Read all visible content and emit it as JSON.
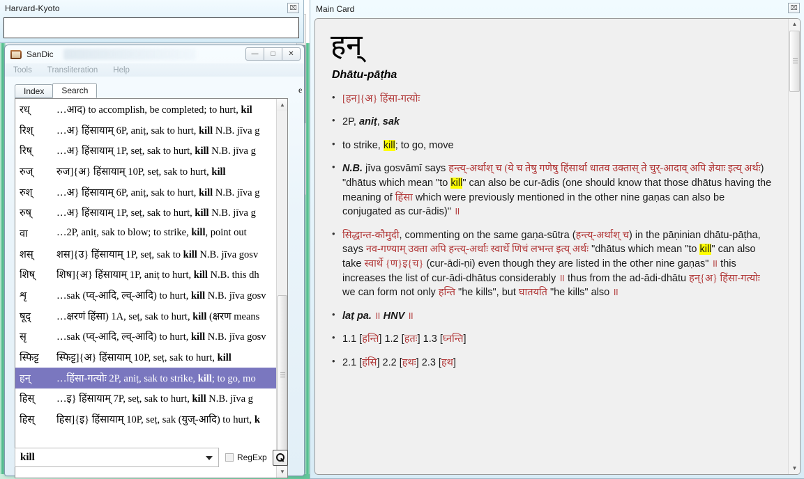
{
  "harvard_kyoto": {
    "title": "Harvard-Kyoto",
    "close_label": "⌧",
    "input_value": "",
    "input_placeholder": ""
  },
  "sandic": {
    "title": "SanDic",
    "window_buttons": {
      "minimize": "—",
      "maximize": "□",
      "close": "✕"
    },
    "menu": [
      "Tools",
      "Transliteration",
      "Help"
    ],
    "tabs": [
      {
        "label": "Index",
        "active": false
      },
      {
        "label": "Search",
        "active": true
      }
    ],
    "list_rows": [
      {
        "headword": "रध्",
        "gloss_pre": "…आद) to accomplish, be completed; to hurt, ",
        "gloss_bold": "kil",
        "gloss_post": "",
        "selected": false
      },
      {
        "headword": "रिश्",
        "gloss_pre": "…अ} हिंसायाम् 6P, aniṭ, sak to hurt, ",
        "gloss_bold": "kill",
        "gloss_post": " N.B. jīva g",
        "selected": false
      },
      {
        "headword": "रिष्",
        "gloss_pre": "…अ} हिंसायाम् 1P, seṭ, sak to hurt, ",
        "gloss_bold": "kill",
        "gloss_post": " N.B. jīva g",
        "selected": false
      },
      {
        "headword": "रुज्",
        "gloss_pre": "रुज]{अ} हिंसायाम् 10P, seṭ, sak to hurt, ",
        "gloss_bold": "kill",
        "gloss_post": "",
        "selected": false
      },
      {
        "headword": "रुश्",
        "gloss_pre": "…अ} हिंसायाम् 6P, aniṭ, sak to hurt, ",
        "gloss_bold": "kill",
        "gloss_post": " N.B. jīva g",
        "selected": false
      },
      {
        "headword": "रुष्",
        "gloss_pre": "…अ} हिंसायाम् 1P, seṭ, sak to hurt, ",
        "gloss_bold": "kill",
        "gloss_post": " N.B. jīva g",
        "selected": false
      },
      {
        "headword": "वा",
        "gloss_pre": "…2P, aniṭ, sak to blow; to strike, ",
        "gloss_bold": "kill",
        "gloss_post": ", point out",
        "selected": false
      },
      {
        "headword": "शस्",
        "gloss_pre": "शस]{उ} हिंसायाम् 1P, seṭ, sak to ",
        "gloss_bold": "kill",
        "gloss_post": " N.B. jīva gosv",
        "selected": false
      },
      {
        "headword": "शिष्",
        "gloss_pre": "शिष]{अ} हिंसायाम् 1P, aniṭ to hurt, ",
        "gloss_bold": "kill",
        "gloss_post": " N.B. this dh",
        "selected": false
      },
      {
        "headword": "शृ",
        "gloss_pre": "…sak (प्व्-आदि, ल्व्-आदि) to hurt, ",
        "gloss_bold": "kill",
        "gloss_post": " N.B. jīva gosv",
        "selected": false
      },
      {
        "headword": "षूद्",
        "gloss_pre": "…क्षरणं हिंसा) 1A, seṭ, sak to hurt, ",
        "gloss_bold": "kill",
        "gloss_post": " (क्षरण means",
        "selected": false
      },
      {
        "headword": "सृ",
        "gloss_pre": "…sak (प्व्-आदि, ल्व्-आदि) to hurt, ",
        "gloss_bold": "kill",
        "gloss_post": " N.B. jīva gosv",
        "selected": false
      },
      {
        "headword": "स्फिट्ट",
        "gloss_pre": "स्फिट्ट]{अ} हिंसायाम् 10P, seṭ, sak to hurt, ",
        "gloss_bold": "kill",
        "gloss_post": "",
        "selected": false
      },
      {
        "headword": "हन्",
        "gloss_pre": "…हिंसा-गत्योः 2P, aniṭ, sak to strike, ",
        "gloss_bold": "kill",
        "gloss_post": "; to go, mo",
        "selected": true
      },
      {
        "headword": "हिस्",
        "gloss_pre": "…इ} हिंसायाम् 7P, seṭ, sak to hurt, ",
        "gloss_bold": "kill",
        "gloss_post": " N.B. jīva g",
        "selected": false
      },
      {
        "headword": "हिस्",
        "gloss_pre": "हिस]{इ} हिंसायाम् 10P, seṭ, sak (युज्-आदि) to hurt, ",
        "gloss_bold": "k",
        "gloss_post": "",
        "selected": false
      }
    ],
    "search": {
      "value": "kill",
      "regexp_label": "RegExp",
      "regexp_checked": false,
      "search_icon": "search-icon"
    },
    "scroll": {
      "up_arrow": "▲",
      "down_arrow": "▼"
    }
  },
  "main_card": {
    "title": "Main Card",
    "close_label": "⌧",
    "headword": "हन्",
    "section_title": "Dhātu-pāṭha",
    "scroll": {
      "up_arrow": "▲",
      "down_arrow": "▼"
    },
    "bullets": {
      "b1_dev": "[हन]{अ} हिंसा-गत्योः",
      "b2_plain": "2P, ",
      "b2_ital1": "aniṭ",
      "b2_mid": ", ",
      "b2_ital2": "sak",
      "b3_pre": "to strike, ",
      "b3_hl": "kill",
      "b3_post": "; to go, move",
      "b4_nb": "N.B.",
      "b4_t1": " jīva gosvāmī says ",
      "b4_dev1": "हन्त्य्-अर्थाश् च (ये च तेषु गणेषु हिंसार्था धातव उक्तास् ते चुर्-आदाव् अपि ज्ञेयाः इत्य् अर्थः",
      "b4_t2": ") \"dhātus which mean \"to ",
      "b4_hl": "kill",
      "b4_t3": "\" can also be cur-ādis (one should know that those dhātus having the meaning of ",
      "b4_dev2": "हिंसा",
      "b4_t4": " which were previously mentioned in the other nine gaṇas can also be conjugated as cur-ādis)\"",
      "b4_danda": " ॥",
      "b5_dev1": "सिद्धान्त-कौमुदी",
      "b5_t1": ", commenting on the same gaṇa-sūtra (",
      "b5_dev2": "हन्त्य्-अर्थाश् च",
      "b5_t2": ") in the pāṇinian dhātu-pāṭha, says ",
      "b5_dev3": "नव-गण्याम् उक्ता अपि हन्त्य्-अर्थाः स्वार्थे णिचं लभन्त इत्य् अर्थः",
      "b5_t3": " \"dhātus which mean \"to ",
      "b5_hl": "kill",
      "b5_t4": "\" can also take ",
      "b5_dev4": "स्वार्थे {ण}इ{च}",
      "b5_t5": " (cur-ādi-ṇi) even though they are listed in the other nine gaṇas\"",
      "b5_d1": " ॥ ",
      "b5_t6": "this increases the list of cur-ādi-dhātus considerably",
      "b5_d2": " ॥ ",
      "b5_t7": "thus from the ad-ādi-dhātu ",
      "b5_dev5": "हन्{अ} हिंसा-गत्योः",
      "b5_t8": " we can form not only ",
      "b5_dev6": "हन्ति",
      "b5_t9": " \"he kills\", but ",
      "b5_dev7": "घातयति",
      "b5_t10": " \"he kills\" also",
      "b5_d3": " ॥",
      "b6_i1": "laṭ pa.",
      "b6_d1": " ॥ ",
      "b6_i2": "HNV",
      "b6_d2": " ॥",
      "b7_n1": "1.1 [",
      "b7_d1": "हन्ति",
      "b7_n2": "] 1.2 [",
      "b7_d2": "हतः",
      "b7_n3": "] 1.3 [",
      "b7_d3": "घ्नन्ति",
      "b7_n4": "]",
      "b8_n1": "2.1 [",
      "b8_d1": "हंसि",
      "b8_n2": "] 2.2 [",
      "b8_d2": "हथः",
      "b8_n3": "] 2.3 [",
      "b8_d3": "हथ",
      "b8_n4": "]"
    }
  },
  "colors": {
    "selection": "#7a77bf",
    "highlight": "#ffff00",
    "devanagari": "#b23a3a",
    "desktop_accent": "#4cbe8c"
  }
}
